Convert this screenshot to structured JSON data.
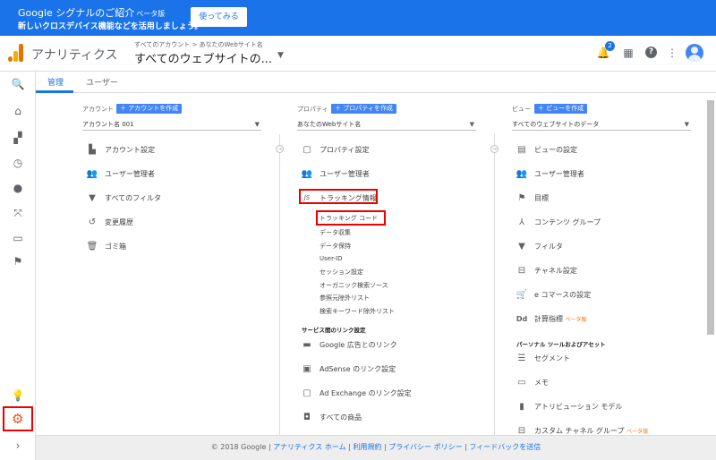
{
  "banner": {
    "title": "Google シグナルのご紹介",
    "beta": "ベータ版",
    "subtitle": "新しいクロスデバイス機能などを活用しましょう。",
    "button": "使ってみる"
  },
  "header": {
    "app_name": "アナリティクス",
    "breadcrumb_small": "すべてのアカウント > あなたのWebサイト名",
    "breadcrumb_big": "すべてのウェブサイトの...",
    "notification_count": "2",
    "brand_colors": [
      "#f9ab00",
      "#e37400"
    ]
  },
  "tabs": {
    "admin": "管理",
    "user": "ユーザー"
  },
  "tooltip": "管理",
  "account": {
    "label": "アカウント",
    "create": "アカウントを作成",
    "selected": "アカウント名 001",
    "items": [
      "アカウント設定",
      "ユーザー管理者",
      "すべてのフィルタ",
      "変更履歴",
      "ゴミ箱"
    ]
  },
  "property": {
    "label": "プロパティ",
    "create": "プロパティを作成",
    "selected": "あなたのWebサイト名",
    "items": [
      "プロパティ設定",
      "ユーザー管理者"
    ],
    "tracking": "トラッキング情報",
    "tracking_icon": "JS",
    "sub_items": [
      "トラッキング コード",
      "データ収集",
      "データ保持",
      "User-ID",
      "セッション設定",
      "オーガニック検索ソース",
      "参照元除外リスト",
      "検索キーワード除外リスト"
    ],
    "link_section": "サービス間のリンク設定",
    "links": [
      "Google 広告とのリンク",
      "AdSense のリンク設定",
      "Ad Exchange のリンク設定",
      "すべての商品"
    ]
  },
  "view": {
    "label": "ビュー",
    "create": "ビューを作成",
    "selected": "すべてのウェブサイトのデータ",
    "items": [
      "ビューの設定",
      "ユーザー管理者",
      "目標",
      "コンテンツ グループ",
      "フィルタ",
      "チャネル設定",
      "e コマースの設定",
      "計算指標"
    ],
    "calc_beta": "ベータ版",
    "calc_icon": "Dd",
    "personal_section": "パーソナル ツールおよびアセット",
    "personal_items": [
      "セグメント",
      "メモ",
      "アトリビューション モデル",
      "カスタム チャネル グループ"
    ],
    "custom_beta": "ベータ版"
  },
  "footer": {
    "copyright": "© 2018 Google",
    "sep": "|",
    "links": [
      "アナリティクス ホーム",
      "利用規約",
      "プライバシー ポリシー",
      "フィードバックを送信"
    ]
  }
}
